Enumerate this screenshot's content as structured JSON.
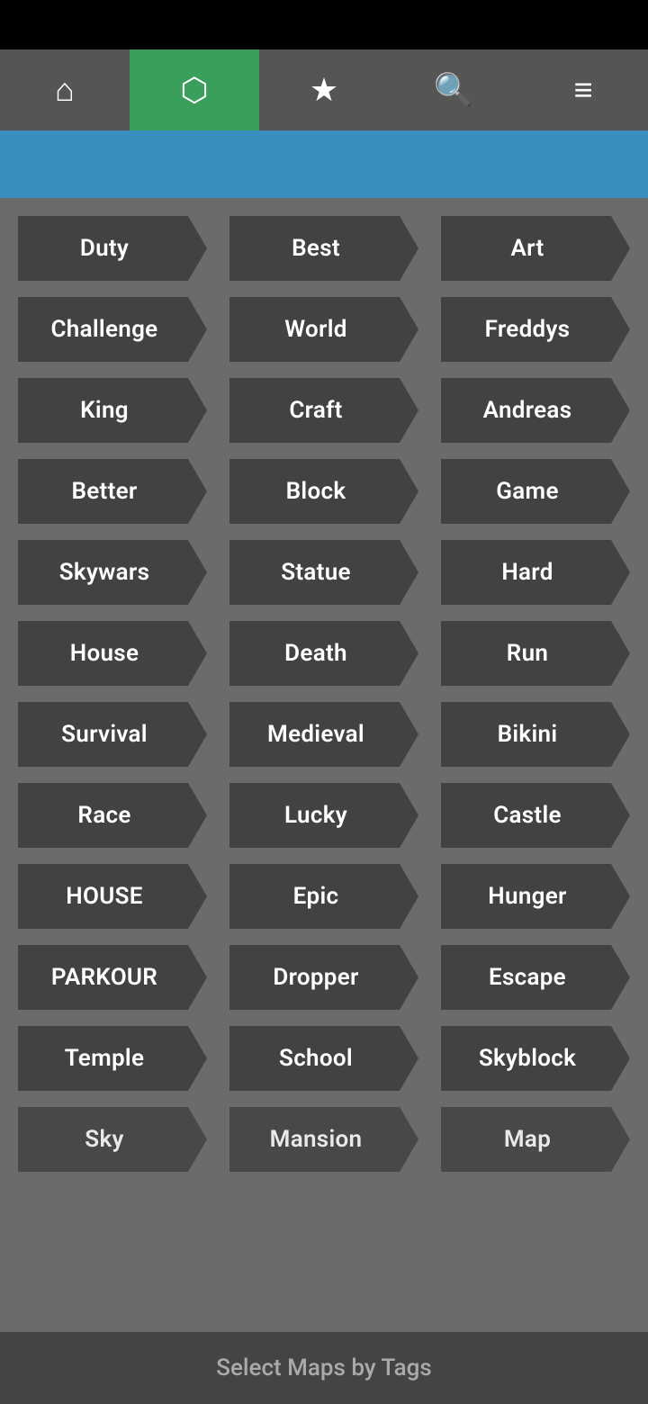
{
  "statusBar": {},
  "navBar": {
    "items": [
      {
        "id": "home",
        "icon": "⌂",
        "active": false
      },
      {
        "id": "tag",
        "icon": "⬡",
        "active": true
      },
      {
        "id": "star",
        "icon": "★",
        "active": false
      },
      {
        "id": "search",
        "icon": "🔍",
        "active": false
      },
      {
        "id": "menu",
        "icon": "≡",
        "active": false
      }
    ]
  },
  "tags": {
    "rows": [
      [
        "Duty",
        "Best",
        "Art"
      ],
      [
        "Challenge",
        "World",
        "Freddys"
      ],
      [
        "King",
        "Craft",
        "Andreas"
      ],
      [
        "Better",
        "Block",
        "Game"
      ],
      [
        "Skywars",
        "Statue",
        "Hard"
      ],
      [
        "House",
        "Death",
        "Run"
      ],
      [
        "Survival",
        "Medieval",
        "Bikini"
      ],
      [
        "Race",
        "Lucky",
        "Castle"
      ],
      [
        "HOUSE",
        "Epic",
        "Hunger"
      ],
      [
        "PARKOUR",
        "Dropper",
        "Escape"
      ],
      [
        "Temple",
        "School",
        "Skyblock"
      ],
      [
        "Sky",
        "Mansion",
        "Map"
      ]
    ]
  },
  "bottomBar": {
    "label": "Select Maps by Tags"
  }
}
